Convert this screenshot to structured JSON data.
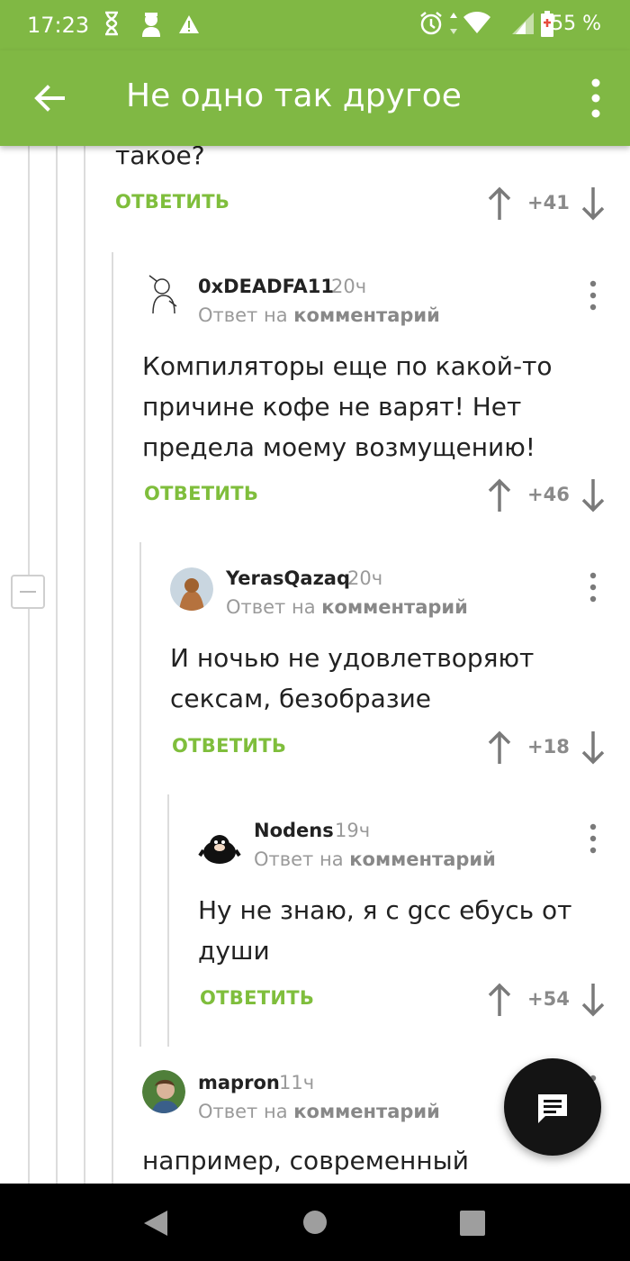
{
  "status_bar": {
    "time": "17:23",
    "battery": "55 %",
    "icons": [
      "hourglass-icon",
      "face-icon",
      "warning-icon",
      "alarm-icon",
      "data-arrows-icon",
      "wifi-icon",
      "signal-icon",
      "battery-icon"
    ]
  },
  "app_bar": {
    "title": "Не одно так другое",
    "back_icon": "arrow-back-icon",
    "menu_icon": "more-vert-icon"
  },
  "colors": {
    "accent": "#80b844",
    "reply": "#7fbe3c",
    "meta": "#9a9a9a"
  },
  "prev_comment": {
    "text_tail": "такое?",
    "reply_label": "ОТВЕТИТЬ",
    "rating": "+41"
  },
  "comments": [
    {
      "author": "0xDEADFA11",
      "time": "20ч",
      "reply_prefix": "Ответ на",
      "reply_target": "комментарий",
      "text": "Компиляторы еще по какой-то причине кофе не варят! Нет предела моему возмущению!",
      "reply_label": "ОТВЕТИТЬ",
      "rating": "+46"
    },
    {
      "author": "YerasQazaq",
      "time": "20ч",
      "reply_prefix": "Ответ на",
      "reply_target": "комментарий",
      "text": "И ночью не удовлетворяют сексам, безобразие",
      "reply_label": "ОТВЕТИТЬ",
      "rating": "+18"
    },
    {
      "author": "Nodens",
      "time": "19ч",
      "reply_prefix": "Ответ на",
      "reply_target": "комментарий",
      "text": "Ну не знаю, я с gcc ебусь от души",
      "reply_label": "ОТВЕТИТЬ",
      "rating": "+54"
    },
    {
      "author": "mapron",
      "time": "11ч",
      "reply_prefix": "Ответ на",
      "reply_target": "комментарий",
      "text": "например, современный"
    }
  ],
  "fab": {
    "icon": "comment-icon"
  },
  "nav_bar": {
    "icons": [
      "nav-back-icon",
      "nav-home-icon",
      "nav-recents-icon"
    ]
  }
}
